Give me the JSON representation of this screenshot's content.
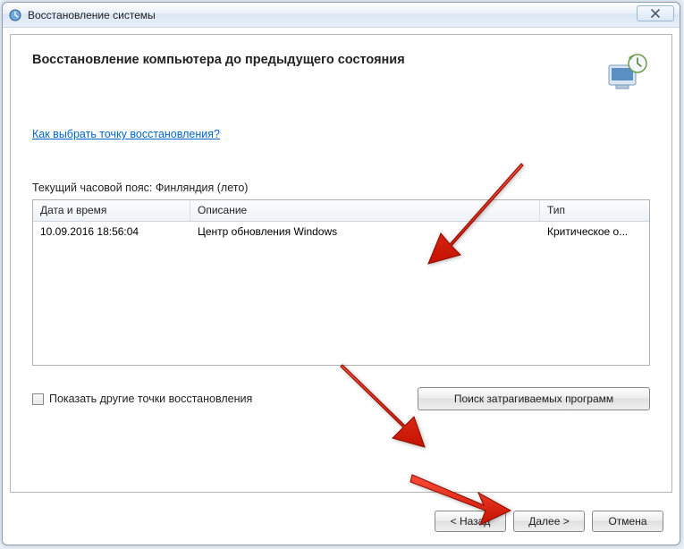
{
  "window": {
    "title": "Восстановление системы"
  },
  "main": {
    "heading": "Восстановление компьютера до предыдущего состояния",
    "help_link": "Как выбрать точку восстановления?",
    "timezone_label": "Текущий часовой пояс: Финляндия (лето)",
    "columns": {
      "date": "Дата и время",
      "desc": "Описание",
      "type": "Тип"
    },
    "rows": [
      {
        "date": "10.09.2016 18:56:04",
        "desc": "Центр обновления Windows",
        "type": "Критическое о..."
      }
    ],
    "show_more_checkbox": "Показать другие точки восстановления",
    "affected_programs_btn": "Поиск затрагиваемых программ"
  },
  "footer": {
    "back": "< Назад",
    "next": "Далее >",
    "cancel": "Отмена"
  }
}
